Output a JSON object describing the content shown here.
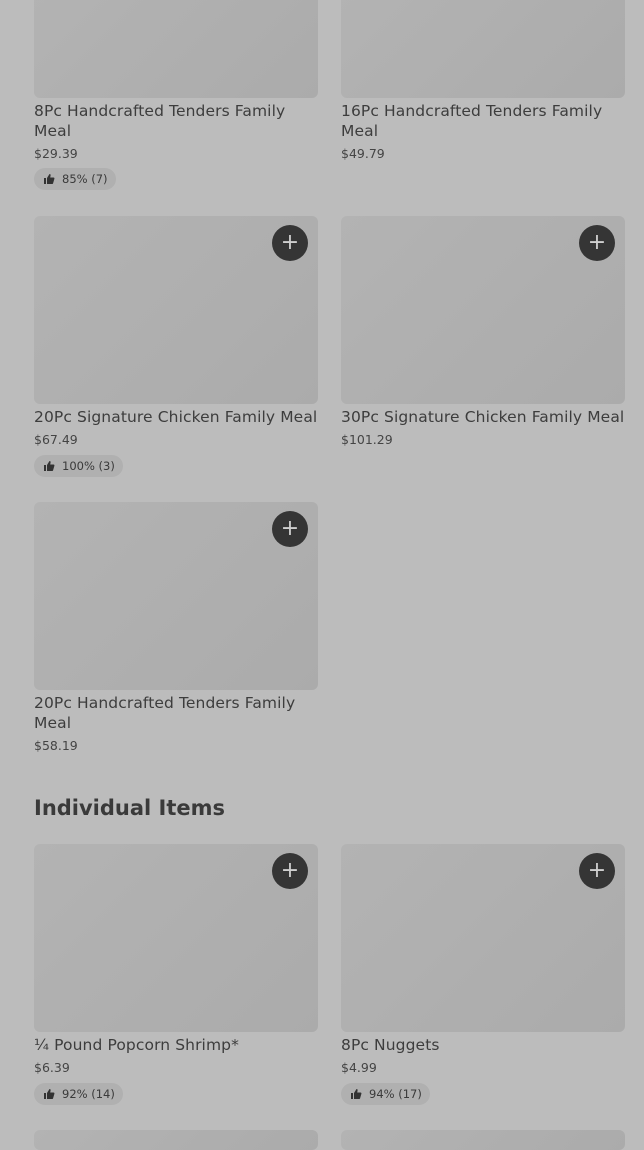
{
  "family_meals": [
    {
      "title": "8Pc Handcrafted Tenders Family Meal",
      "price": "$29.39",
      "rating": "85% (7)"
    },
    {
      "title": "16Pc Handcrafted Tenders Family Meal",
      "price": "$49.79"
    },
    {
      "title": "20Pc Signature Chicken Family Meal",
      "price": "$67.49",
      "rating": "100% (3)"
    },
    {
      "title": "30Pc Signature Chicken Family Meal",
      "price": "$101.29"
    },
    {
      "title": "20Pc Handcrafted Tenders Family Meal",
      "price": "$58.19"
    }
  ],
  "individual": {
    "heading": "Individual Items",
    "items": [
      {
        "title": "¼ Pound Popcorn Shrimp*",
        "price": "$6.39",
        "rating": "92% (14)"
      },
      {
        "title": "8Pc Nuggets",
        "price": "$4.99",
        "rating": "94% (17)"
      }
    ]
  },
  "icons": {
    "add": "plus-icon",
    "rating": "thumbs-up-icon"
  },
  "add_glyph": "+"
}
